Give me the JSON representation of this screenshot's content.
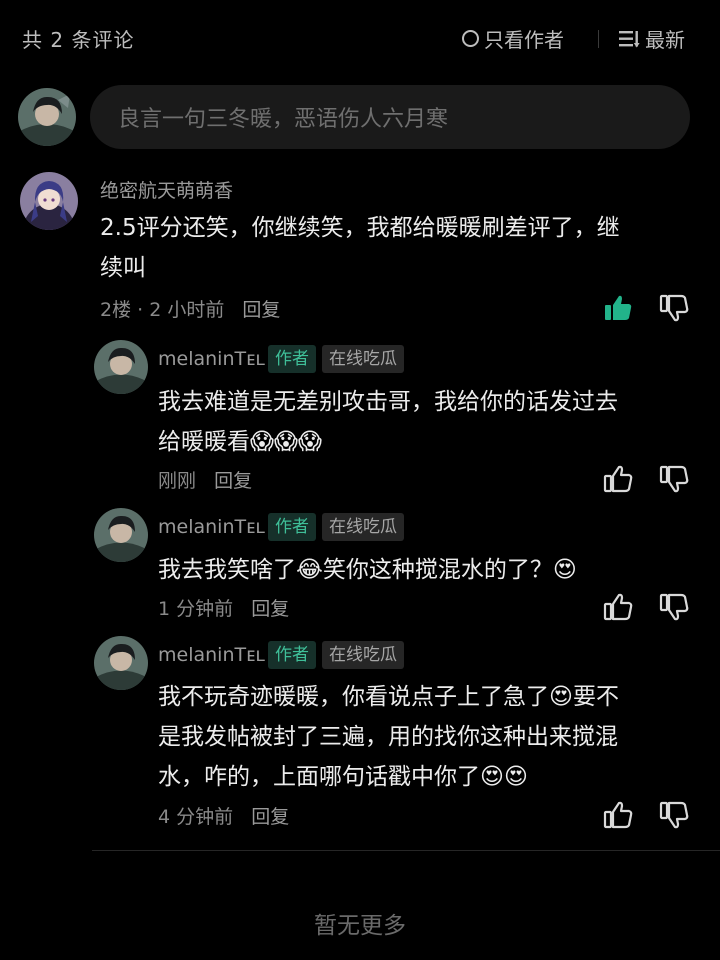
{
  "header": {
    "comment_count": "共 2 条评论",
    "author_only_label": "只看作者",
    "sort_label": "最新"
  },
  "compose": {
    "placeholder": "良言一句三冬暖，恶语伤人六月寒"
  },
  "comments": [
    {
      "username": "绝密航天萌萌香",
      "text_line1": "2.5评分还笑，你继续笑，我都给暖暖刷差评了，继",
      "text_line2": "续叫",
      "floor": "2楼",
      "time": "2 小时前",
      "reply_label": "回复",
      "liked": true,
      "replies": [
        {
          "username": "melaninTᴇʟ",
          "author_tag": "作者",
          "badge": "在线吃瓜",
          "text_line1": "我去难道是无差别攻击哥，我给你的话发过去",
          "text_line2": "给暖暖看😱😱😱",
          "time": "刚刚",
          "reply_label": "回复"
        },
        {
          "username": "melaninTᴇʟ",
          "author_tag": "作者",
          "badge": "在线吃瓜",
          "text_line1": "我去我笑啥了😂笑你这种搅混水的了？😍",
          "time": "1 分钟前",
          "reply_label": "回复"
        },
        {
          "username": "melaninTᴇʟ",
          "author_tag": "作者",
          "badge": "在线吃瓜",
          "text_line1": "我不玩奇迹暖暖，你看说点子上了急了😍要不",
          "text_line2": "是我发帖被封了三遍，用的找你这种出来搅混",
          "text_line3": "水，咋的，上面哪句话戳中你了😍😍",
          "time": "4 分钟前",
          "reply_label": "回复"
        }
      ]
    }
  ],
  "footer": {
    "no_more": "暂无更多"
  },
  "colors": {
    "background": "#000000",
    "liked_accent": "#22b38a",
    "author_tag_text": "#3fbf99"
  }
}
